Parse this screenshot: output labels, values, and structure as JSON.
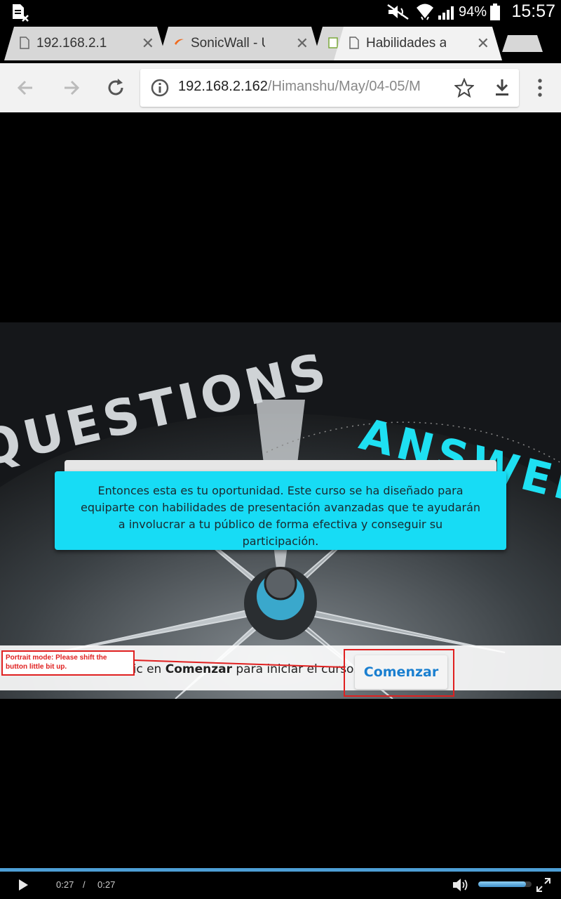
{
  "status_bar": {
    "battery_percent": "94%",
    "time": "15:57"
  },
  "tabs": [
    {
      "title": "192.168.2.1",
      "active": false
    },
    {
      "title": "SonicWall - User",
      "active": false
    },
    {
      "title": "",
      "active": false
    },
    {
      "title": "Habilidades ava",
      "active": true
    }
  ],
  "address_bar": {
    "host": "192.168.2.162",
    "path": "/Himanshu/May/04-05/M"
  },
  "slide": {
    "background_words": {
      "left": "QUESTIONS",
      "right": "ANSWERS"
    },
    "info_text": "Entonces esta es tu oportunidad. Este curso se ha diseñado para equiparte con habilidades de presentación avanzadas que te ayudarán a involucrar a tu público de forma efectiva y conseguir su participación.",
    "prompt_prefix": "Haz clic en ",
    "prompt_bold": "Comenzar",
    "prompt_suffix": " para iniciar el curso.",
    "begin_button": "Comenzar"
  },
  "annotation": {
    "text": "Portrait mode: Please shift the button little bit up."
  },
  "video": {
    "current_time": "0:27",
    "separator": "/",
    "duration": "0:27",
    "progress": 1.0,
    "volume": 0.9
  },
  "colors": {
    "accent_cyan": "#17dcf5",
    "button_text": "#1a7fd0",
    "annotation_red": "#e02020",
    "progress_blue": "#4d9fd6"
  }
}
